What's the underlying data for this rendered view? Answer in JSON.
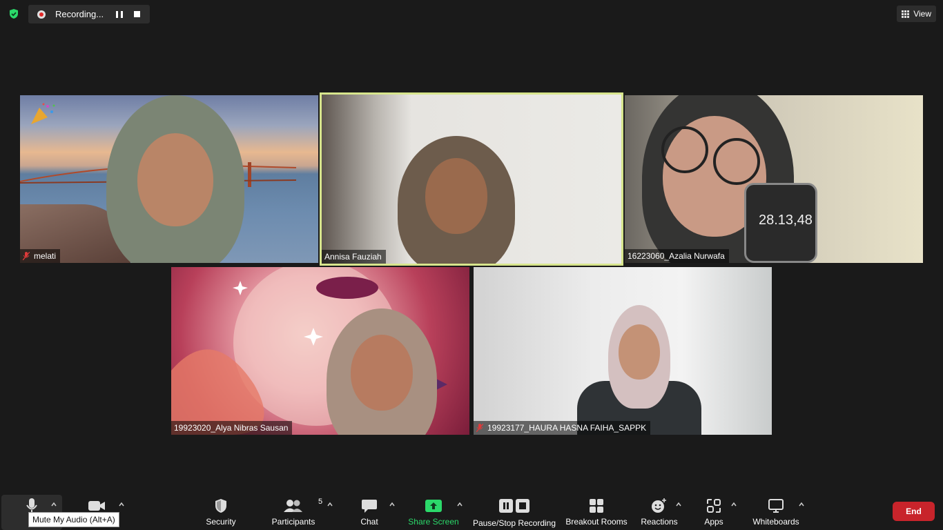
{
  "top": {
    "recording_status": "Recording...",
    "view_label": "View"
  },
  "participants": [
    {
      "name": "melati",
      "muted": true,
      "active": false
    },
    {
      "name": "Annisa Fauziah",
      "muted": false,
      "active": true
    },
    {
      "name": "16223060_Azalia Nurwafa",
      "muted": false,
      "active": false,
      "phone_time": "28.13,48"
    },
    {
      "name": "19923020_Alya Nibras Sausan",
      "muted": false,
      "active": false
    },
    {
      "name": "19923177_HAURA HASNA FAIHA_SAPPK",
      "muted": true,
      "active": false
    }
  ],
  "toolbar": {
    "mute_label": "Mute",
    "mute_label_visible": "M",
    "mute_tooltip": "Mute My Audio (Alt+A)",
    "video_label": "",
    "security_label": "Security",
    "participants_label": "Participants",
    "participants_count": "5",
    "chat_label": "Chat",
    "share_label": "Share Screen",
    "recording_label": "Pause/Stop Recording",
    "breakout_label": "Breakout Rooms",
    "reactions_label": "Reactions",
    "apps_label": "Apps",
    "whiteboards_label": "Whiteboards",
    "end_label": "End"
  },
  "colors": {
    "background": "#1a1a1a",
    "active_speaker_border": "#d7e58c",
    "share_green": "#2bd96a",
    "end_red": "#c8242b",
    "security_shield": "#2bd96a"
  }
}
